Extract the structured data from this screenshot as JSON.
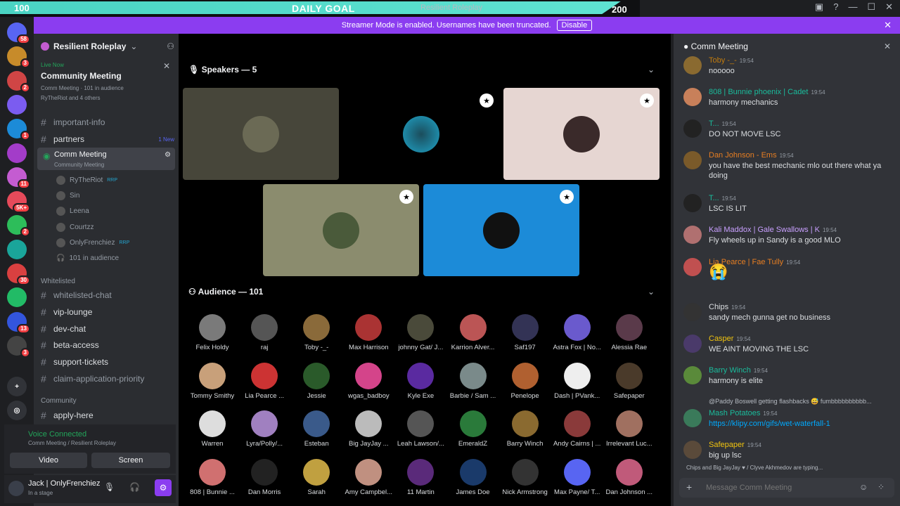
{
  "goal": {
    "left": "100",
    "title": "DAILY GOAL",
    "right": "200",
    "progress": 0.97
  },
  "window_title": "Resilient Roleplay",
  "banner": {
    "text": "Streamer Mode is enabled. Usernames have been truncated.",
    "button": "Disable"
  },
  "rail_badges": [
    "58",
    "3",
    "2",
    "",
    "1",
    "",
    "11",
    "5K+",
    "2",
    "",
    "30",
    "",
    "13",
    "3"
  ],
  "sidebar": {
    "server": "Resilient Roleplay",
    "live": {
      "tag": "Live Now",
      "title": "Community Meeting",
      "sub": "Comm Meeting",
      "audience": "101 in audience",
      "speakers": "RyTheRiot and 4 others"
    },
    "channels_top": [
      {
        "name": "important-info"
      },
      {
        "name": "partners",
        "new": "1 New"
      }
    ],
    "stage_channel": {
      "name": "Comm Meeting",
      "sub": "Community Meeting"
    },
    "members": [
      {
        "name": "RyTheRiot",
        "tag": "RRP"
      },
      {
        "name": "Sin",
        "tag": ""
      },
      {
        "name": "Leena",
        "tag": ""
      },
      {
        "name": "Courtzz",
        "tag": ""
      },
      {
        "name": "OnlyFrenchiez",
        "tag": "RRP"
      }
    ],
    "audience_line": "101 in audience",
    "cat_whitelisted": "Whitelisted",
    "channels_wl": [
      "whitelisted-chat",
      "vip-lounge",
      "dev-chat",
      "beta-access",
      "support-tickets",
      "claim-application-priority"
    ],
    "cat_community": "Community",
    "channels_comm": [
      "apply-here"
    ],
    "voice": {
      "status": "Voice Connected",
      "where": "Comm Meeting / Resilient Roleplay",
      "video": "Video",
      "screen": "Screen"
    },
    "user": {
      "name": "Jack | OnlyFrenchiez",
      "status": "In a stage"
    }
  },
  "stage": {
    "speakers_title": "Speakers — 5",
    "audience_title": "Audience — 101",
    "audience": [
      "Felix Holdy",
      "raj",
      "Toby -_-",
      "Max Harrison",
      "johnny Gat/ J...",
      "Karrion Alver...",
      "Saf197",
      "Astra Fox | No...",
      "Alessia Rae",
      "Tommy Smithy",
      "Lia Pearce ...",
      "Jessie",
      "wgas_badboy",
      "Kyle Exe",
      "Barbie / Sam ...",
      "Penelope",
      "Dash | PVank...",
      "Safepaper",
      "Warren",
      "Lyra/Polly/...",
      "Esteban",
      "Big JayJay ...",
      "Leah Lawson/...",
      "EmeraldZ",
      "Barry Winch",
      "Andy Cairns | ...",
      "Irrelevant Luc...",
      "808 | Bunnie ...",
      "Dan Morris",
      "Sarah",
      "Amy Campbel...",
      "11 Martin",
      "James Doe",
      "Nick Armstrong",
      "Max Payne/ T...",
      "Dan Johnson ..."
    ]
  },
  "chat": {
    "title": "Comm Meeting",
    "messages": [
      {
        "who": "Toby -_-",
        "time": "19:54",
        "text": "nooooo",
        "color": "#c27c0e"
      },
      {
        "who": "808 | Bunnie phoenix | Cadet",
        "time": "19:54",
        "text": "harmony mechanics",
        "color": "#1abc9c"
      },
      {
        "who": "T...",
        "time": "19:54",
        "text": "DO NOT MOVE LSC",
        "color": "#1abc9c"
      },
      {
        "who": "Dan Johnson - Ems",
        "time": "19:54",
        "text": "you have the best mechanic mlo out there what ya doing",
        "color": "#e67e22"
      },
      {
        "who": "T...",
        "time": "19:54",
        "text": "LSC IS LIT",
        "color": "#1abc9c"
      },
      {
        "who": "Kali Maddox | Gale Swallows | K",
        "time": "19:54",
        "text": "Fly wheels up in Sandy is a good MLO",
        "color": "#c9a0ff"
      },
      {
        "who": "Lia Pearce | Fae Tully",
        "time": "19:54",
        "text": "😭",
        "color": "#e67e22"
      },
      {
        "who": "Chips",
        "time": "19:54",
        "text": "sandy mech gunna get no business",
        "color": "#dbdee1"
      },
      {
        "who": "Casper",
        "time": "19:54",
        "text": "WE AINT MOVING THE LSC",
        "color": "#f1c40f"
      },
      {
        "who": "Barry Winch",
        "time": "19:54",
        "text": "harmony is elite",
        "color": "#1abc9c"
      },
      {
        "who": "Mash Potatoes",
        "time": "19:54",
        "text": "https://klipy.com/gifs/wet-waterfall-1",
        "color": "#1abc9c"
      },
      {
        "who": "Safepaper",
        "time": "19:54",
        "text": "big up lsc",
        "color": "#f1c40f"
      }
    ],
    "reply": "@Paddy Boswell getting flashbacks 😅 fumbbbbbbbbbb...",
    "typing": "Chips and Big JayJay ♥ / Clyve Akhmedov are typing...",
    "placeholder": "Message Comm Meeting"
  }
}
